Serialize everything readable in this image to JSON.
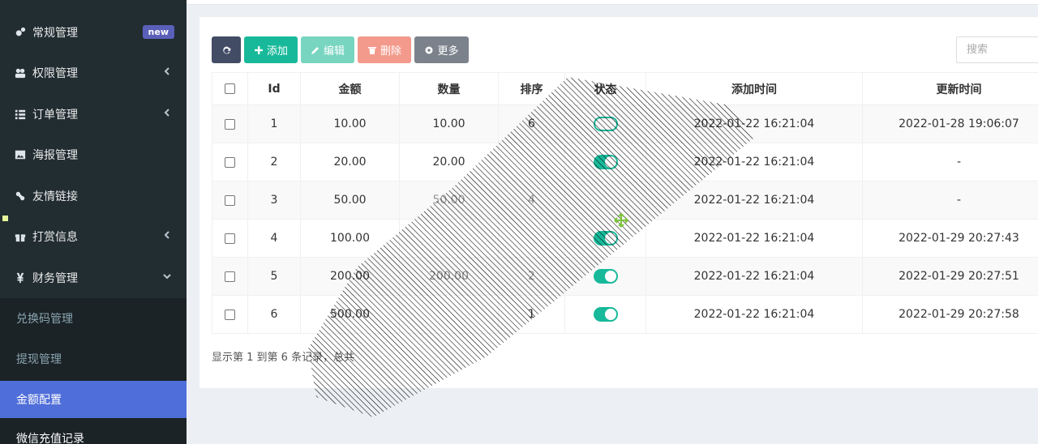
{
  "sidebar": {
    "items": [
      {
        "label": "常规管理",
        "icon": "cogs-icon",
        "badge": "new"
      },
      {
        "label": "权限管理",
        "icon": "group-icon",
        "chevron": "left"
      },
      {
        "label": "订单管理",
        "icon": "list-icon",
        "chevron": "left"
      },
      {
        "label": "海报管理",
        "icon": "image-icon"
      },
      {
        "label": "友情链接",
        "icon": "link-icon"
      },
      {
        "label": "打赏信息",
        "icon": "gift-icon",
        "chevron": "left"
      },
      {
        "label": "财务管理",
        "icon": "yen-icon",
        "chevron": "down"
      }
    ],
    "subitems": [
      {
        "label": "兑换码管理",
        "icon": "code-icon"
      },
      {
        "label": "提现管理",
        "icon": "card-icon"
      },
      {
        "label": "金额配置",
        "icon": "leaf-icon",
        "active": true
      },
      {
        "label": "微信充值记录",
        "icon": "wechat-icon"
      }
    ]
  },
  "toolbar": {
    "add_label": "添加",
    "edit_label": "编辑",
    "delete_label": "删除",
    "more_label": "更多"
  },
  "search": {
    "placeholder": "搜索"
  },
  "table": {
    "columns": [
      "Id",
      "金额",
      "数量",
      "排序",
      "状态",
      "添加时间",
      "更新时间"
    ],
    "rows": [
      {
        "id": "1",
        "amount": "10.00",
        "qty": "10.00",
        "sort": "6",
        "status": "off",
        "created": "2022-01-22 16:21:04",
        "updated": "2022-01-28 19:06:07"
      },
      {
        "id": "2",
        "amount": "20.00",
        "qty": "20.00",
        "sort": "",
        "status": "on",
        "created": "2022-01-22 16:21:04",
        "updated": "-"
      },
      {
        "id": "3",
        "amount": "50.00",
        "qty": "50.00",
        "sort": "4",
        "status": "",
        "created": "2022-01-22 16:21:04",
        "updated": "-"
      },
      {
        "id": "4",
        "amount": "100.00",
        "qty": "",
        "sort": "",
        "status": "on",
        "created": "2022-01-22 16:21:04",
        "updated": "2022-01-29 20:27:43"
      },
      {
        "id": "5",
        "amount": "200.00",
        "qty": "200.00",
        "sort": "2",
        "status": "on",
        "created": "2022-01-22 16:21:04",
        "updated": "2022-01-29 20:27:51"
      },
      {
        "id": "6",
        "amount": "500.00",
        "qty": "",
        "sort": "1",
        "status": "on",
        "created": "2022-01-22 16:21:04",
        "updated": "2022-01-29 20:27:58"
      }
    ]
  },
  "footer": {
    "text": "显示第 1 到第 6 条记录，总共"
  },
  "colors": {
    "sidebar_bg": "#222d32",
    "active": "#4f6ed9",
    "accent": "#18b99a"
  }
}
